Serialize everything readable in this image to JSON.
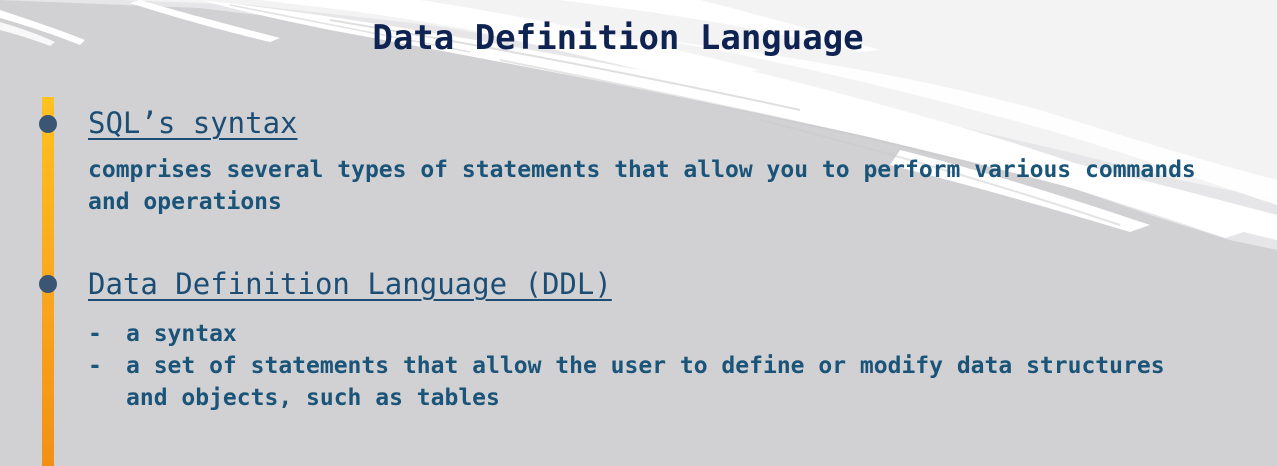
{
  "slide": {
    "title": "Data Definition Language",
    "sections": [
      {
        "heading": "SQL’s syntax",
        "body": "comprises several types of statements that allow you to perform various commands and operations"
      },
      {
        "heading": "Data Definition Language (DDL)",
        "items": [
          "a syntax",
          "a set of statements that allow the user to define or modify data structures and objects, such as tables"
        ]
      }
    ],
    "dash_glyph": "-"
  },
  "colors": {
    "background": "#d1d0d2",
    "title": "#0f2352",
    "heading": "#1c4d74",
    "body": "#1b5479",
    "bullet": "#3b5574",
    "accent_bar": "#f9a81e"
  }
}
